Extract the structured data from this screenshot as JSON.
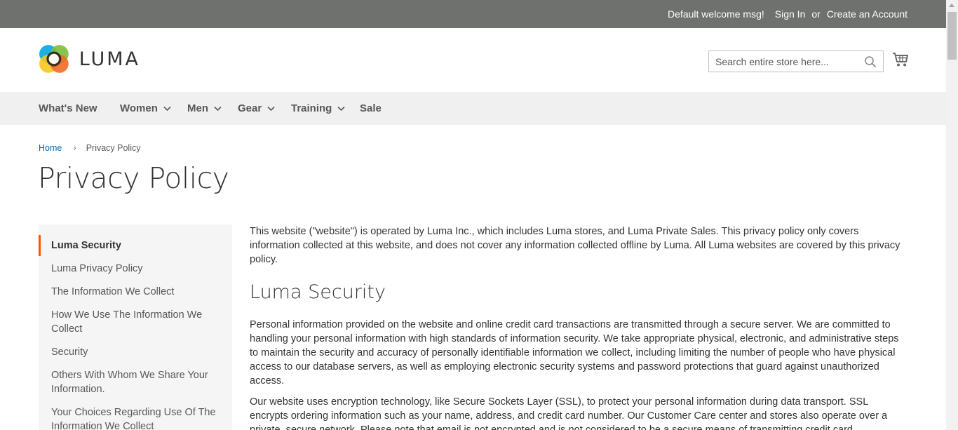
{
  "panel": {
    "welcome": "Default welcome msg!",
    "sign_in": "Sign In",
    "or": "or",
    "create_account": "Create an Account"
  },
  "header": {
    "logo_text": "LUMA",
    "search_placeholder": "Search entire store here...",
    "search_value": ""
  },
  "nav": {
    "items": [
      {
        "label": "What's New",
        "has_dropdown": false
      },
      {
        "label": "Women",
        "has_dropdown": true
      },
      {
        "label": "Men",
        "has_dropdown": true
      },
      {
        "label": "Gear",
        "has_dropdown": true
      },
      {
        "label": "Training",
        "has_dropdown": true
      },
      {
        "label": "Sale",
        "has_dropdown": false
      }
    ]
  },
  "breadcrumb": {
    "home": "Home",
    "separator": "›",
    "current": "Privacy Policy"
  },
  "page_title": "Privacy Policy",
  "sidebar": {
    "items": [
      {
        "label": "Luma Security",
        "active": true
      },
      {
        "label": "Luma Privacy Policy",
        "active": false
      },
      {
        "label": "The Information We Collect",
        "active": false
      },
      {
        "label": "How We Use The Information We Collect",
        "active": false
      },
      {
        "label": "Security",
        "active": false
      },
      {
        "label": "Others With Whom We Share Your Information.",
        "active": false
      },
      {
        "label": "Your Choices Regarding Use Of The Information We Collect",
        "active": false
      }
    ]
  },
  "content": {
    "intro": "This website (\"website\") is operated by Luma Inc., which includes Luma stores, and Luma Private Sales. This privacy policy only covers information collected at this website, and does not cover any information collected offline by Luma. All Luma websites are covered by this privacy policy.",
    "section_heading": "Luma Security",
    "para1": "Personal information provided on the website and online credit card transactions are transmitted through a secure server. We are committed to handling your personal information with high standards of information security. We take appropriate physical, electronic, and administrative steps to maintain the security and accuracy of personally identifiable information we collect, including limiting the number of people who have physical access to our database servers, as well as employing electronic security systems and password protections that guard against unauthorized access.",
    "para2": "Our website uses encryption technology, like Secure Sockets Layer (SSL), to protect your personal information during data transport. SSL encrypts ordering information such as your name, address, and credit card number. Our Customer Care center and stores also operate over a private, secure network. Please note that email is not encrypted and is not considered to be a secure means of transmitting credit card"
  },
  "colors": {
    "panel_bg": "#6e716e",
    "nav_bg": "#f0f0f0",
    "sidebar_bg": "#f5f5f5",
    "accent": "#ff5501",
    "link": "#006bb4"
  }
}
